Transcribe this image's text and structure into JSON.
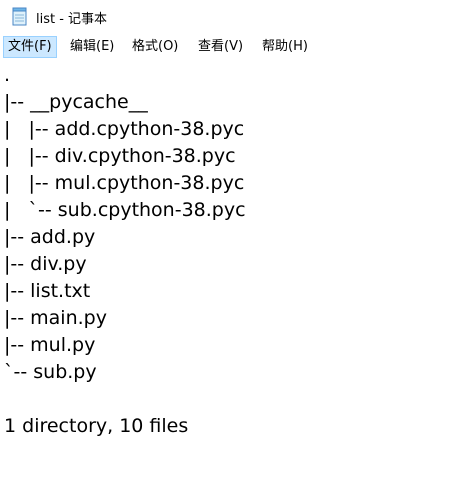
{
  "window": {
    "title": "list - 记事本"
  },
  "menu": {
    "items": [
      {
        "label": "文件(F)"
      },
      {
        "label": "编辑(E)"
      },
      {
        "label": "格式(O)"
      },
      {
        "label": "查看(V)"
      },
      {
        "label": "帮助(H)"
      }
    ]
  },
  "editor": {
    "lines": [
      ".",
      "|-- __pycache__",
      "|   |-- add.cpython-38.pyc",
      "|   |-- div.cpython-38.pyc",
      "|   |-- mul.cpython-38.pyc",
      "|   `-- sub.cpython-38.pyc",
      "|-- add.py",
      "|-- div.py",
      "|-- list.txt",
      "|-- main.py",
      "|-- mul.py",
      "`-- sub.py",
      "",
      "1 directory, 10 files"
    ]
  }
}
